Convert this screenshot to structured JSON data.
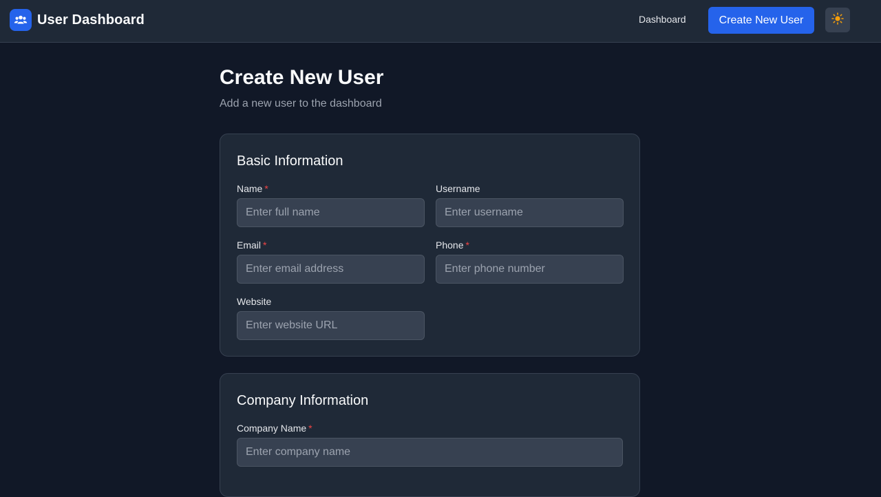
{
  "header": {
    "brand_title": "User Dashboard",
    "brand_icon": "users-icon",
    "nav": {
      "dashboard_label": "Dashboard"
    },
    "create_button_label": "Create New User",
    "theme_toggle_icon": "sun-icon"
  },
  "page": {
    "title": "Create New User",
    "subtitle": "Add a new user to the dashboard"
  },
  "basic_info": {
    "title": "Basic Information",
    "name": {
      "label": "Name",
      "required": "*",
      "placeholder": "Enter full name",
      "value": ""
    },
    "username": {
      "label": "Username",
      "placeholder": "Enter username",
      "value": ""
    },
    "email": {
      "label": "Email",
      "required": "*",
      "placeholder": "Enter email address",
      "value": ""
    },
    "phone": {
      "label": "Phone",
      "required": "*",
      "placeholder": "Enter phone number",
      "value": ""
    },
    "website": {
      "label": "Website",
      "placeholder": "Enter website URL",
      "value": ""
    }
  },
  "company_info": {
    "title": "Company Information",
    "company_name": {
      "label": "Company Name",
      "required": "*",
      "placeholder": "Enter company name",
      "value": ""
    }
  },
  "colors": {
    "background": "#111827",
    "surface": "#1f2937",
    "input": "#374151",
    "accent": "#2563eb",
    "required": "#ef4444",
    "sun": "#f59e0b"
  }
}
